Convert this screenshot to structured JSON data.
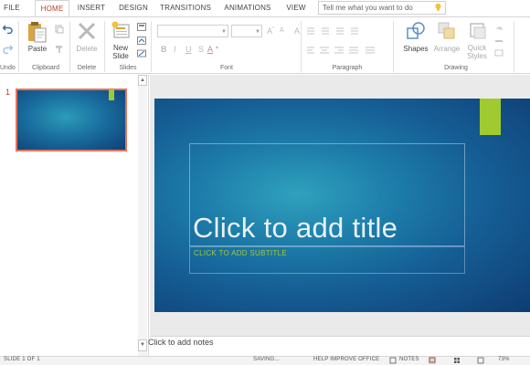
{
  "tabs": [
    "FILE",
    "HOME",
    "INSERT",
    "DESIGN",
    "TRANSITIONS",
    "ANIMATIONS",
    "VIEW"
  ],
  "search": {
    "placeholder": "Tell me what you want to do"
  },
  "ribbon": {
    "undo_group": "Undo",
    "clipboard": {
      "paste": "Paste",
      "group": "Clipboard"
    },
    "delete": {
      "button": "Delete",
      "group": "Delete"
    },
    "slides": {
      "new_slide_line1": "New",
      "new_slide_line2": "Slide",
      "group": "Slides"
    },
    "font": {
      "bold": "B",
      "italic": "I",
      "underline": "U",
      "font_color": "A",
      "group": "Font"
    },
    "paragraph": {
      "group": "Paragraph"
    },
    "drawing": {
      "shapes": "Shapes",
      "arrange": "Arrange",
      "quick_styles_line1": "Quick",
      "quick_styles_line2": "Styles",
      "group": "Drawing"
    }
  },
  "thumbnails": [
    {
      "number": "1"
    }
  ],
  "slide": {
    "title_placeholder": "Click to add title",
    "subtitle_placeholder": "CLICK TO ADD SUBTITLE"
  },
  "notes": {
    "placeholder": "Click to add notes"
  },
  "status": {
    "slide_info": "SLIDE 1 OF 1",
    "saving": "SAVING...",
    "help_improve": "HELP IMPROVE OFFICE",
    "notes": "NOTES",
    "zoom": "73%"
  },
  "colors": {
    "accent_tab": "#c43e1c",
    "slide_accent": "#9fcb31",
    "subtitle": "#a4c93a",
    "selection_border": "#e5745a"
  },
  "icons": [
    "undo-icon",
    "redo-icon",
    "paste-icon",
    "delete-icon",
    "new-slide-icon",
    "bulb-icon",
    "shapes-icon",
    "arrange-icon",
    "quick-styles-icon"
  ]
}
